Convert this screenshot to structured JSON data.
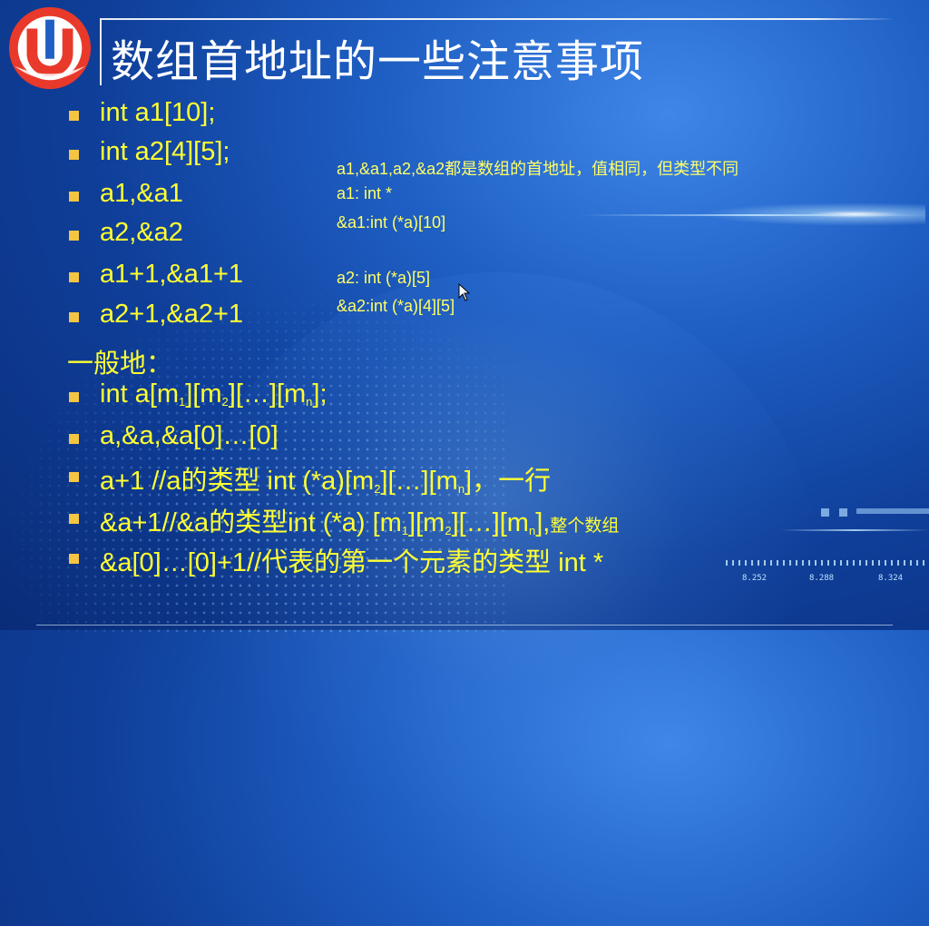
{
  "slide": {
    "title": "数组首地址的一些注意事项",
    "bullets": [
      "int a1[10];",
      "int a2[4][5];",
      "a1,&a1",
      "a2,&a2",
      "a1+1,&a1+1",
      "a2+1,&a2+1"
    ],
    "general_heading": "一般地：",
    "general_bullets": [
      {
        "parts": [
          "int a[m",
          "1",
          "][m",
          "2",
          "][…][m",
          "n",
          "];"
        ]
      },
      {
        "parts": [
          "a,&a,&a[0]…[0]"
        ]
      },
      {
        "parts": [
          "a+1 //a的类型 int (*a)[m",
          "2",
          "][…][m",
          "n",
          "]，一行"
        ]
      },
      {
        "parts": [
          "&a+1//&a的类型int (*a) [m",
          "1",
          "][m",
          "2",
          "][…][m",
          "n",
          "],",
          "整个数组"
        ]
      },
      {
        "parts": [
          "&a[0]…[0]+1//代表的第一个元素的类型 int *"
        ]
      }
    ],
    "notes": [
      "a1,&a1,a2,&a2都是数组的首地址，值相同，但类型不同",
      "a1: int *",
      "&a1:int (*a)[10]",
      "a2: int (*a)[5]",
      "&a2:int (*a)[4][5]"
    ],
    "decor_numbers": [
      "8.252",
      "8.288",
      "8.324"
    ]
  },
  "colors": {
    "text_yellow": "#ffff33",
    "bullet": "#f4c542",
    "title": "#ffffff",
    "background": "#1f5fc4"
  },
  "icons": {
    "logo": "university-logo-icon",
    "cursor": "mouse-cursor-icon"
  }
}
